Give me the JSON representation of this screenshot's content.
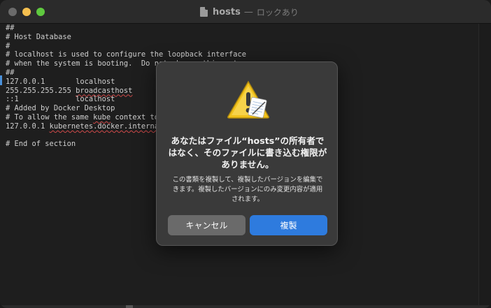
{
  "window": {
    "title": "hosts",
    "title_separator": "—",
    "title_status": "ロックあり"
  },
  "editor": {
    "lines": [
      {
        "text": "##"
      },
      {
        "text": "# Host Database"
      },
      {
        "text": "#"
      },
      {
        "text": "# localhost is used to configure the loopback interface"
      },
      {
        "text": "# when the system is booting.  Do not change this entry."
      },
      {
        "text": "##"
      },
      {
        "pre": "127.0.0.1       ",
        "sq": "",
        "post": "localhost"
      },
      {
        "pre": "255.255.255.255 ",
        "sq": "broadcasthost",
        "post": ""
      },
      {
        "pre": "::1             ",
        "sq": "",
        "post": "localhost"
      },
      {
        "text": "# Added by Docker Desktop"
      },
      {
        "pre": "# To allow the same ",
        "sq": "kube",
        "post": " context to work on the host and the container:"
      },
      {
        "pre": "127.0.0.1 ",
        "sq": "kubernetes.docker.internal",
        "post": ""
      },
      {
        "text": ""
      },
      {
        "text": "# End of section"
      }
    ]
  },
  "dialog": {
    "title": "あなたはファイル“hosts”の所有者ではなく、そのファイルに書き込む権限がありません。",
    "message": "この書類を複製して、複製したバージョンを編集できます。複製したバージョンにのみ変更内容が適用されます。",
    "cancel_label": "キャンセル",
    "duplicate_label": "複製",
    "icon": "warning-icon",
    "colors": {
      "primary_button": "#2e7bde",
      "secondary_button": "#6a6a6a",
      "warning_yellow": "#f2c21b"
    }
  }
}
